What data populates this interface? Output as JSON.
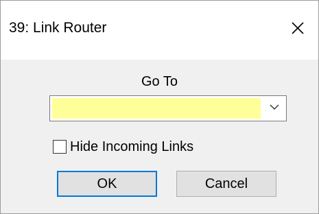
{
  "window": {
    "title": "39: Link Router",
    "close_icon": "close-icon"
  },
  "form": {
    "goto_label": "Go To",
    "goto_value": "",
    "goto_field_color": "#ffff99",
    "dropdown_icon": "chevron-down-icon",
    "hide_incoming_label": "Hide Incoming Links",
    "hide_incoming_checked": false
  },
  "buttons": {
    "ok_label": "OK",
    "cancel_label": "Cancel",
    "default_accent": "#0078d7"
  }
}
